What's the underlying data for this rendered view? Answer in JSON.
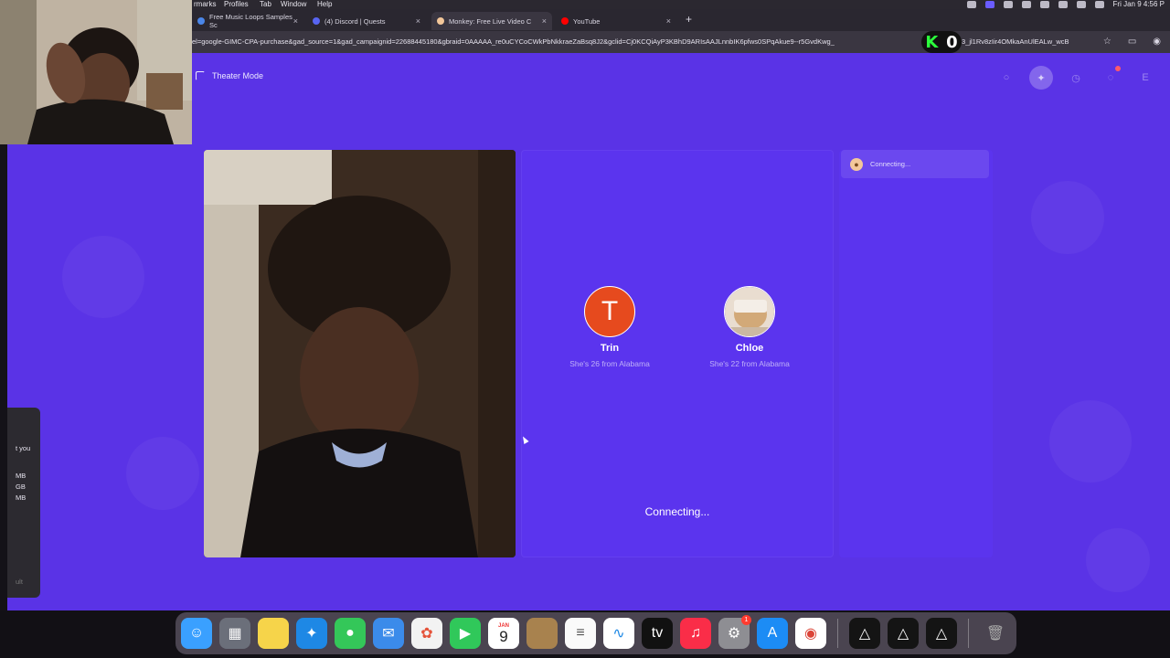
{
  "menubar": {
    "items": [
      "rmarks",
      "Profiles",
      "Tab",
      "Window",
      "Help"
    ],
    "clock": "Fri Jan 9  4:56 P"
  },
  "tabs": [
    {
      "title": "Free Music Loops Samples Sc",
      "favicon_color": "#4a86e8"
    },
    {
      "title": "(4) Discord | Quests",
      "favicon_color": "#5865f2"
    },
    {
      "title": "Monkey: Free Live Video C",
      "favicon_color": "#f3c79a",
      "active": true
    },
    {
      "title": "YouTube",
      "favicon_color": "#ff0000"
    }
  ],
  "address": {
    "url": "el=google-GIMC-CPA-purchase&gad_source=1&gad_campaignid=22688445180&gbraid=0AAAAA_re0uCYCoCWkPbNkkraeZaBsq8J2&gclid=Cj0KCQiAyP3KBhD9ARIsAAJLnnbIK6pfws0SPqAkue9--r5GvdKwg_",
    "url_tail": "3_jl1Rv8zIir4OMkaAnUlEALw_wcB",
    "overlay_letter": "K",
    "overlay_count": "0"
  },
  "page": {
    "theater_label": "Theater Mode",
    "match": {
      "people": [
        {
          "initial": "T",
          "name": "Trin",
          "info": "She's 26 from Alabama"
        },
        {
          "initial": "",
          "name": "Chloe",
          "info": "She's 22 from Alabama"
        }
      ],
      "status": "Connecting..."
    },
    "chat": {
      "status": "Connecting..."
    }
  },
  "sidepanel": {
    "lines": [
      "t you",
      "MB",
      "GB",
      "MB",
      "ult"
    ]
  },
  "dock": {
    "calendar_month": "JAN",
    "calendar_day": "9",
    "settings_badge": "1",
    "colors": {
      "finder": "#3aa0ff",
      "notes": "#f6d44a",
      "safari": "#1e88e5",
      "messages": "#34c759",
      "mail": "#3b8bea",
      "facetime": "#30c85a",
      "music": "#fa2d48",
      "appstore": "#1c8cf5"
    }
  },
  "colors": {
    "page_bg": "#5a33e6",
    "panel_bg": "#5b34ee",
    "avatar_t": "#e64a1e"
  }
}
